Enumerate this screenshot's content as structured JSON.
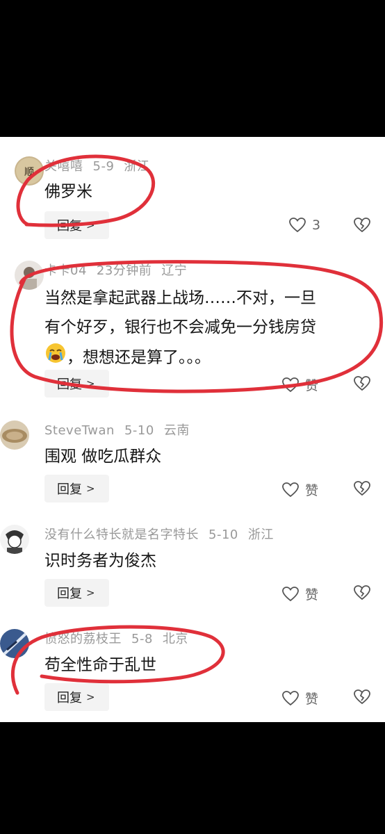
{
  "comments": [
    {
      "user": "关嘻嘻",
      "date": "5-9",
      "location": "浙江",
      "text": "佛罗米",
      "reply_label": "回复",
      "like_label": "3"
    },
    {
      "user": "卡卡04",
      "date": "23分钟前",
      "location": "辽宁",
      "text_line1": "当然是拿起武器上战场……不对，一旦",
      "text_line2": "有个好歹，银行也不会减免一分钱房贷",
      "text_line3": "，想想还是算了。。。",
      "reply_label": "回复",
      "like_label": "赞"
    },
    {
      "user": "SteveTwan",
      "date": "5-10",
      "location": "云南",
      "text": "围观 做吃瓜群众",
      "reply_label": "回复",
      "like_label": "赞"
    },
    {
      "user": "没有什么特长就是名字特长",
      "date": "5-10",
      "location": "浙江",
      "text": "识时务者为俊杰",
      "reply_label": "回复",
      "like_label": "赞"
    },
    {
      "user": "愤怒的荔枝王",
      "date": "5-8",
      "location": "北京",
      "text": "苟全性命于乱世",
      "reply_label": "回复",
      "like_label": "赞"
    }
  ],
  "colors": {
    "annotation_red": "#e0303a",
    "meta_gray": "#999999"
  },
  "icons": [
    "heart-outline-icon",
    "broken-heart-icon",
    "chevron-right-icon",
    "crying-emoji-icon"
  ]
}
